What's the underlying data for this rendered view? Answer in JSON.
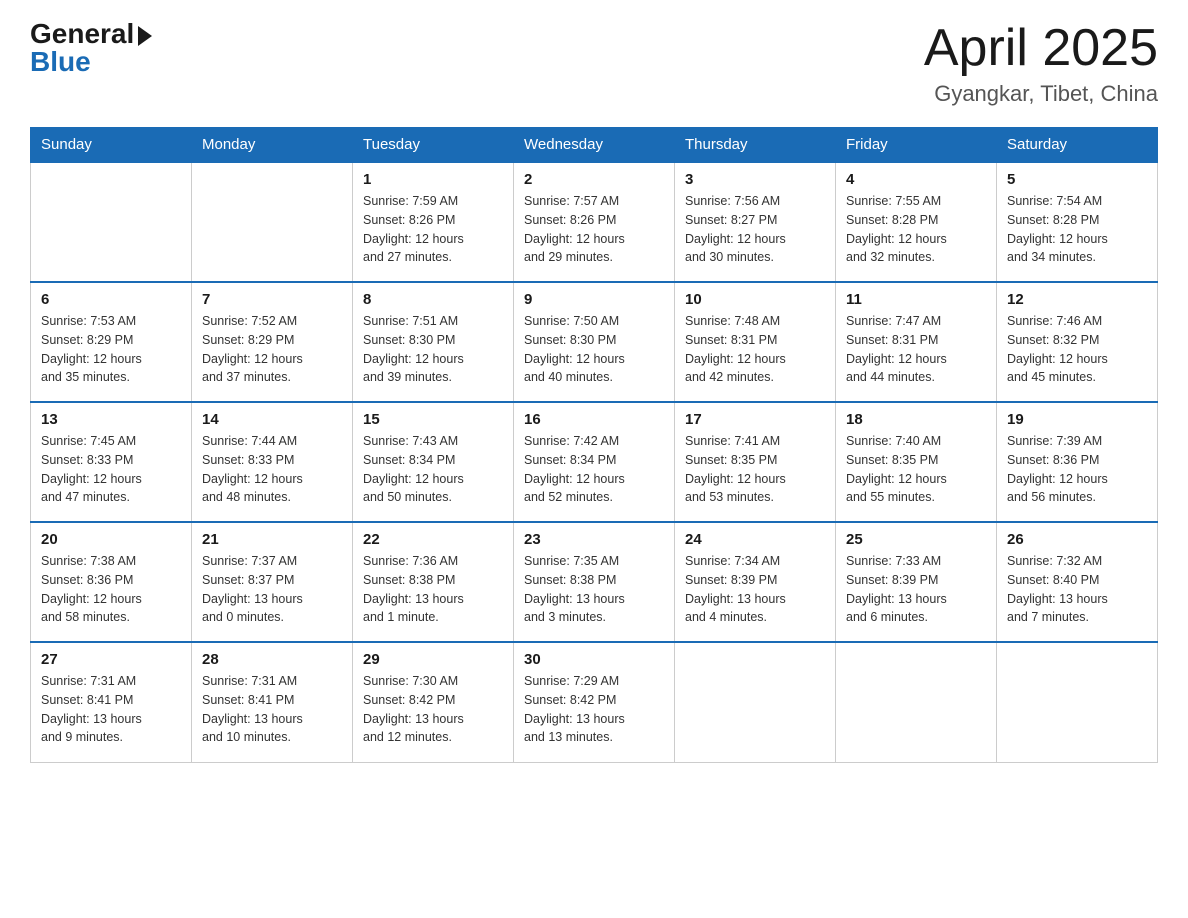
{
  "logo": {
    "general": "General",
    "blue": "Blue"
  },
  "title": "April 2025",
  "location": "Gyangkar, Tibet, China",
  "weekdays": [
    "Sunday",
    "Monday",
    "Tuesday",
    "Wednesday",
    "Thursday",
    "Friday",
    "Saturday"
  ],
  "weeks": [
    [
      {
        "day": "",
        "info": ""
      },
      {
        "day": "",
        "info": ""
      },
      {
        "day": "1",
        "info": "Sunrise: 7:59 AM\nSunset: 8:26 PM\nDaylight: 12 hours\nand 27 minutes."
      },
      {
        "day": "2",
        "info": "Sunrise: 7:57 AM\nSunset: 8:26 PM\nDaylight: 12 hours\nand 29 minutes."
      },
      {
        "day": "3",
        "info": "Sunrise: 7:56 AM\nSunset: 8:27 PM\nDaylight: 12 hours\nand 30 minutes."
      },
      {
        "day": "4",
        "info": "Sunrise: 7:55 AM\nSunset: 8:28 PM\nDaylight: 12 hours\nand 32 minutes."
      },
      {
        "day": "5",
        "info": "Sunrise: 7:54 AM\nSunset: 8:28 PM\nDaylight: 12 hours\nand 34 minutes."
      }
    ],
    [
      {
        "day": "6",
        "info": "Sunrise: 7:53 AM\nSunset: 8:29 PM\nDaylight: 12 hours\nand 35 minutes."
      },
      {
        "day": "7",
        "info": "Sunrise: 7:52 AM\nSunset: 8:29 PM\nDaylight: 12 hours\nand 37 minutes."
      },
      {
        "day": "8",
        "info": "Sunrise: 7:51 AM\nSunset: 8:30 PM\nDaylight: 12 hours\nand 39 minutes."
      },
      {
        "day": "9",
        "info": "Sunrise: 7:50 AM\nSunset: 8:30 PM\nDaylight: 12 hours\nand 40 minutes."
      },
      {
        "day": "10",
        "info": "Sunrise: 7:48 AM\nSunset: 8:31 PM\nDaylight: 12 hours\nand 42 minutes."
      },
      {
        "day": "11",
        "info": "Sunrise: 7:47 AM\nSunset: 8:31 PM\nDaylight: 12 hours\nand 44 minutes."
      },
      {
        "day": "12",
        "info": "Sunrise: 7:46 AM\nSunset: 8:32 PM\nDaylight: 12 hours\nand 45 minutes."
      }
    ],
    [
      {
        "day": "13",
        "info": "Sunrise: 7:45 AM\nSunset: 8:33 PM\nDaylight: 12 hours\nand 47 minutes."
      },
      {
        "day": "14",
        "info": "Sunrise: 7:44 AM\nSunset: 8:33 PM\nDaylight: 12 hours\nand 48 minutes."
      },
      {
        "day": "15",
        "info": "Sunrise: 7:43 AM\nSunset: 8:34 PM\nDaylight: 12 hours\nand 50 minutes."
      },
      {
        "day": "16",
        "info": "Sunrise: 7:42 AM\nSunset: 8:34 PM\nDaylight: 12 hours\nand 52 minutes."
      },
      {
        "day": "17",
        "info": "Sunrise: 7:41 AM\nSunset: 8:35 PM\nDaylight: 12 hours\nand 53 minutes."
      },
      {
        "day": "18",
        "info": "Sunrise: 7:40 AM\nSunset: 8:35 PM\nDaylight: 12 hours\nand 55 minutes."
      },
      {
        "day": "19",
        "info": "Sunrise: 7:39 AM\nSunset: 8:36 PM\nDaylight: 12 hours\nand 56 minutes."
      }
    ],
    [
      {
        "day": "20",
        "info": "Sunrise: 7:38 AM\nSunset: 8:36 PM\nDaylight: 12 hours\nand 58 minutes."
      },
      {
        "day": "21",
        "info": "Sunrise: 7:37 AM\nSunset: 8:37 PM\nDaylight: 13 hours\nand 0 minutes."
      },
      {
        "day": "22",
        "info": "Sunrise: 7:36 AM\nSunset: 8:38 PM\nDaylight: 13 hours\nand 1 minute."
      },
      {
        "day": "23",
        "info": "Sunrise: 7:35 AM\nSunset: 8:38 PM\nDaylight: 13 hours\nand 3 minutes."
      },
      {
        "day": "24",
        "info": "Sunrise: 7:34 AM\nSunset: 8:39 PM\nDaylight: 13 hours\nand 4 minutes."
      },
      {
        "day": "25",
        "info": "Sunrise: 7:33 AM\nSunset: 8:39 PM\nDaylight: 13 hours\nand 6 minutes."
      },
      {
        "day": "26",
        "info": "Sunrise: 7:32 AM\nSunset: 8:40 PM\nDaylight: 13 hours\nand 7 minutes."
      }
    ],
    [
      {
        "day": "27",
        "info": "Sunrise: 7:31 AM\nSunset: 8:41 PM\nDaylight: 13 hours\nand 9 minutes."
      },
      {
        "day": "28",
        "info": "Sunrise: 7:31 AM\nSunset: 8:41 PM\nDaylight: 13 hours\nand 10 minutes."
      },
      {
        "day": "29",
        "info": "Sunrise: 7:30 AM\nSunset: 8:42 PM\nDaylight: 13 hours\nand 12 minutes."
      },
      {
        "day": "30",
        "info": "Sunrise: 7:29 AM\nSunset: 8:42 PM\nDaylight: 13 hours\nand 13 minutes."
      },
      {
        "day": "",
        "info": ""
      },
      {
        "day": "",
        "info": ""
      },
      {
        "day": "",
        "info": ""
      }
    ]
  ]
}
